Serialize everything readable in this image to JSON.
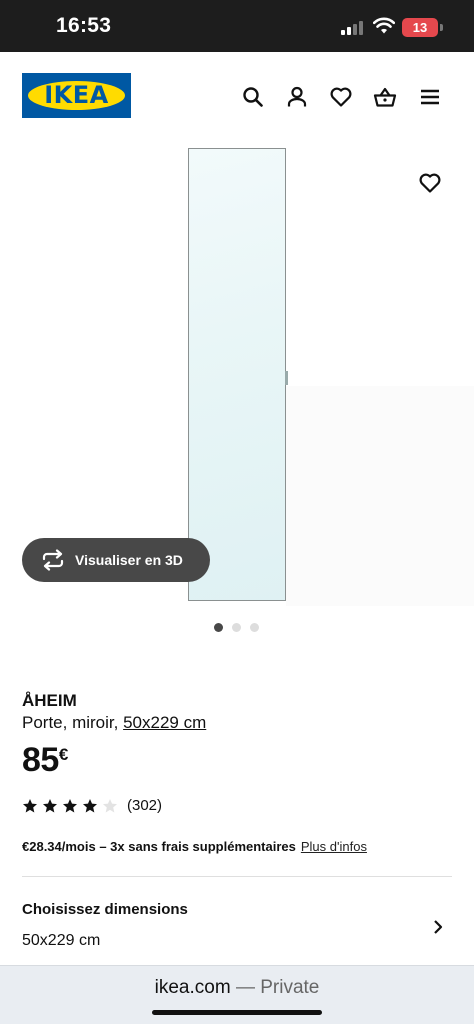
{
  "status_bar": {
    "time": "16:53",
    "battery": "13"
  },
  "header": {
    "logo": "IKEA",
    "icons": [
      "search-icon",
      "account-icon",
      "wishlist-icon",
      "basket-icon",
      "menu-icon"
    ]
  },
  "gallery": {
    "button_3d_label": "Visualiser en 3D",
    "image_count": 3,
    "active_index": 0
  },
  "product": {
    "name": "ÅHEIM",
    "description": "Porte, miroir,",
    "size_link": "50x229 cm",
    "price_integer": "85",
    "price_currency": "€",
    "rating": 4,
    "rating_max": 5,
    "review_count": "(302)",
    "financing": "€28.34/mois – 3x sans frais supplémentaires",
    "financing_link": "Plus d'infos"
  },
  "dimensions": {
    "title": "Choisissez dimensions",
    "value": "50x229 cm"
  },
  "browser": {
    "domain": "ikea.com",
    "separator": "—",
    "mode": "Private"
  },
  "colors": {
    "ikea_blue": "#0058a3",
    "ikea_yellow": "#ffdb00"
  }
}
